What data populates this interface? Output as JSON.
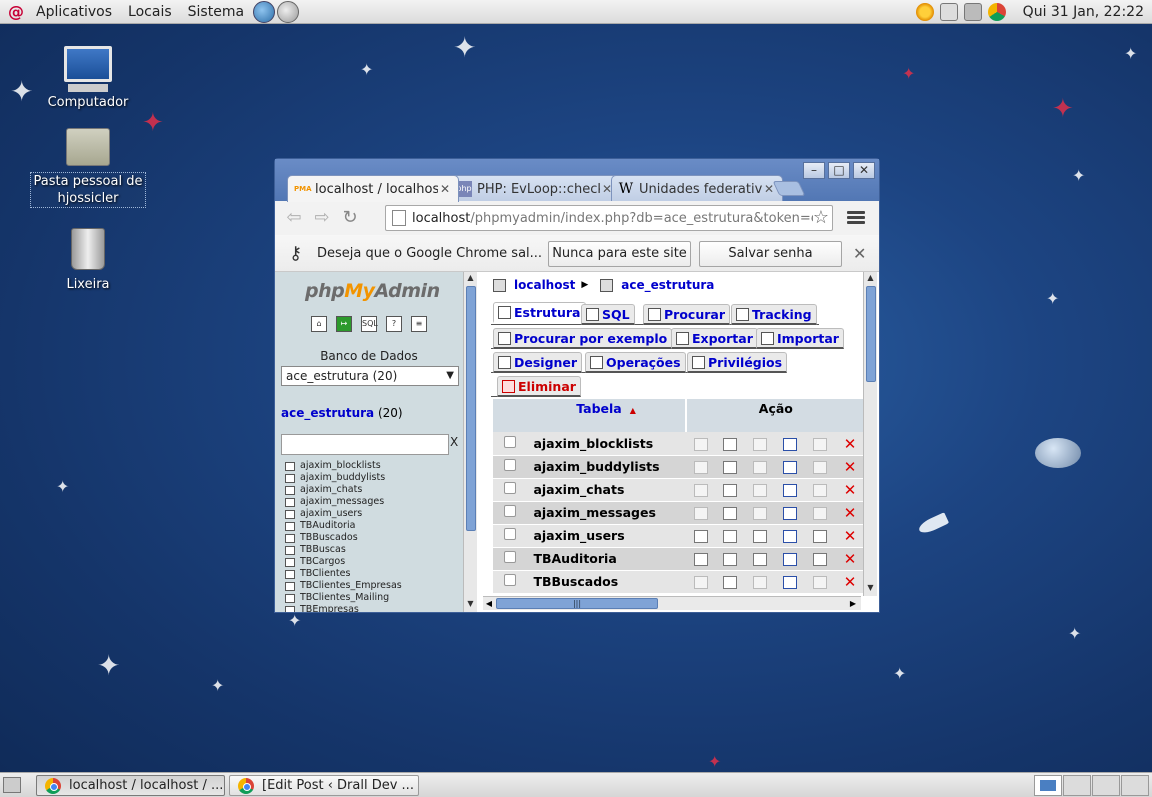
{
  "top_panel": {
    "menu": [
      "Aplicativos",
      "Locais",
      "Sistema"
    ],
    "clock": "Qui 31 Jan, 22:22"
  },
  "desktop": {
    "icons": [
      {
        "label": "Computador"
      },
      {
        "label": "Pasta pessoal de hjossicler"
      },
      {
        "label": "Lixeira"
      }
    ]
  },
  "browser": {
    "tabs": [
      {
        "title": "localhost / localhost",
        "favicon": "PMA",
        "active": true
      },
      {
        "title": "PHP: EvLoop::check",
        "favicon": "php",
        "active": false
      },
      {
        "title": "Unidades federativas",
        "favicon": "W",
        "active": false
      }
    ],
    "url_host": "localhost",
    "url_path": "/phpmyadmin/index.php?db=ace_estrutura&token=e",
    "infobar": {
      "message": "Deseja que o Google Chrome sal...",
      "never_button": "Nunca para este site",
      "save_button": "Salvar senha"
    }
  },
  "pma_nav": {
    "logo_php": "php",
    "logo_my": "My",
    "logo_admin": "Admin",
    "db_label": "Banco de Dados",
    "db_selected": "ace_estrutura (20)",
    "db_link": "ace_estrutura",
    "db_count": "(20)",
    "filter_clear": "X",
    "tables": [
      "ajaxim_blocklists",
      "ajaxim_buddylists",
      "ajaxim_chats",
      "ajaxim_messages",
      "ajaxim_users",
      "TBAuditoria",
      "TBBuscados",
      "TBBuscas",
      "TBCargos",
      "TBClientes",
      "TBClientes_Empresas",
      "TBClientes_Mailing",
      "TBEmpresas"
    ]
  },
  "pma_main": {
    "breadcrumb_server": "localhost",
    "breadcrumb_db": "ace_estrutura",
    "tabs": {
      "estrutura": "Estrutura",
      "sql": "SQL",
      "procurar": "Procurar",
      "tracking": "Tracking",
      "procurar_exemplo": "Procurar por exemplo",
      "exportar": "Exportar",
      "importar": "Importar",
      "designer": "Designer",
      "operacoes": "Operações",
      "privilegios": "Privilégios",
      "eliminar": "Eliminar"
    },
    "table_header": {
      "tabela": "Tabela",
      "acao": "Ação"
    },
    "rows": [
      {
        "name": "ajaxim_blocklists",
        "empty": true
      },
      {
        "name": "ajaxim_buddylists",
        "empty": true
      },
      {
        "name": "ajaxim_chats",
        "empty": true
      },
      {
        "name": "ajaxim_messages",
        "empty": true
      },
      {
        "name": "ajaxim_users",
        "empty": false
      },
      {
        "name": "TBAuditoria",
        "empty": false
      },
      {
        "name": "TBBuscados",
        "empty": true
      }
    ]
  },
  "bottom_panel": {
    "tasks": [
      "localhost / localhost / ...",
      "[Edit Post ‹ Drall Dev ..."
    ]
  },
  "colors": {
    "link": "#0000cc",
    "danger": "#cc0000",
    "pma_orange": "#f29400",
    "chrome_frame": "#5d7fb8"
  }
}
